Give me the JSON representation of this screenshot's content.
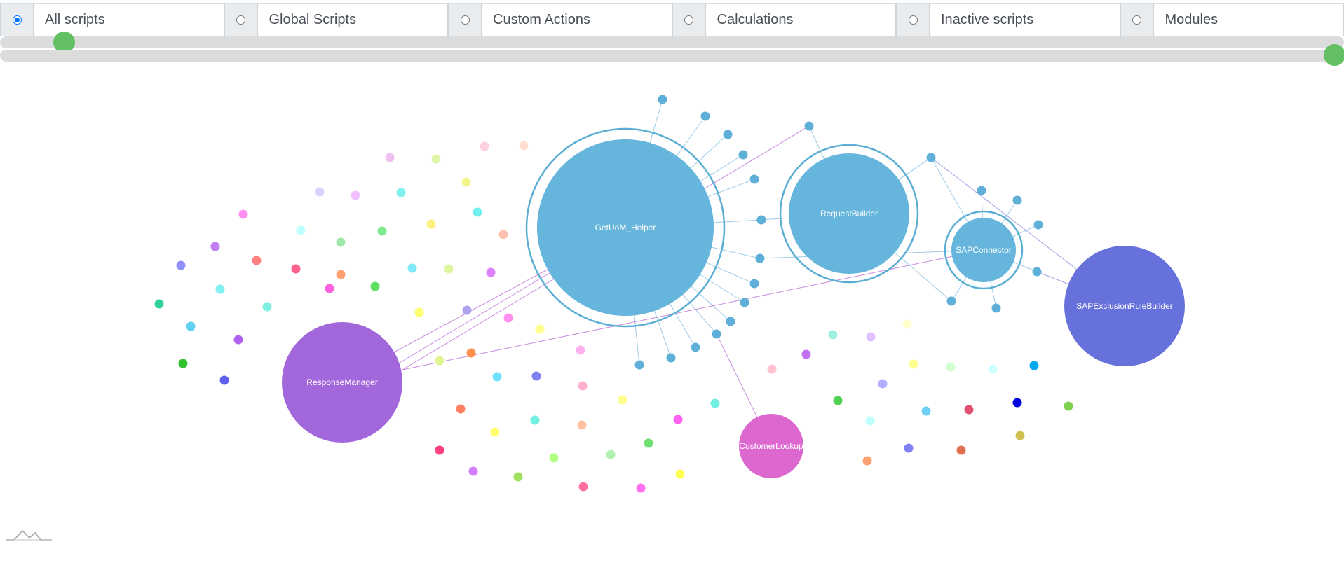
{
  "filters": [
    {
      "label": "All scripts",
      "checked": true
    },
    {
      "label": "Global Scripts",
      "checked": false
    },
    {
      "label": "Custom Actions",
      "checked": false
    },
    {
      "label": "Calculations",
      "checked": false
    },
    {
      "label": "Inactive scripts",
      "checked": false
    },
    {
      "label": "Modules",
      "checked": false
    }
  ],
  "colors": {
    "helper_blue": "#66b5dc",
    "helper_ring": "#5aaed4",
    "link_blue": "#9dcbe6",
    "link_purple": "#c98ae0",
    "response_manager": "#a367dc",
    "customer_lookup": "#dc67ce",
    "sap_exclusion": "#6771dc",
    "slider_thumb": "#5bbd5c",
    "track": "#dcdcdc"
  },
  "graph": {
    "main_nodes": {
      "getuom": "GetUoM_Helper",
      "request_builder": "RequestBuilder",
      "sap_connector": "SAPConnector",
      "sap_exclusion": "SAPExclusionRuleBuilder",
      "response_manager": "ResponseManager",
      "customer_lookup": "CustomerLookup"
    }
  }
}
